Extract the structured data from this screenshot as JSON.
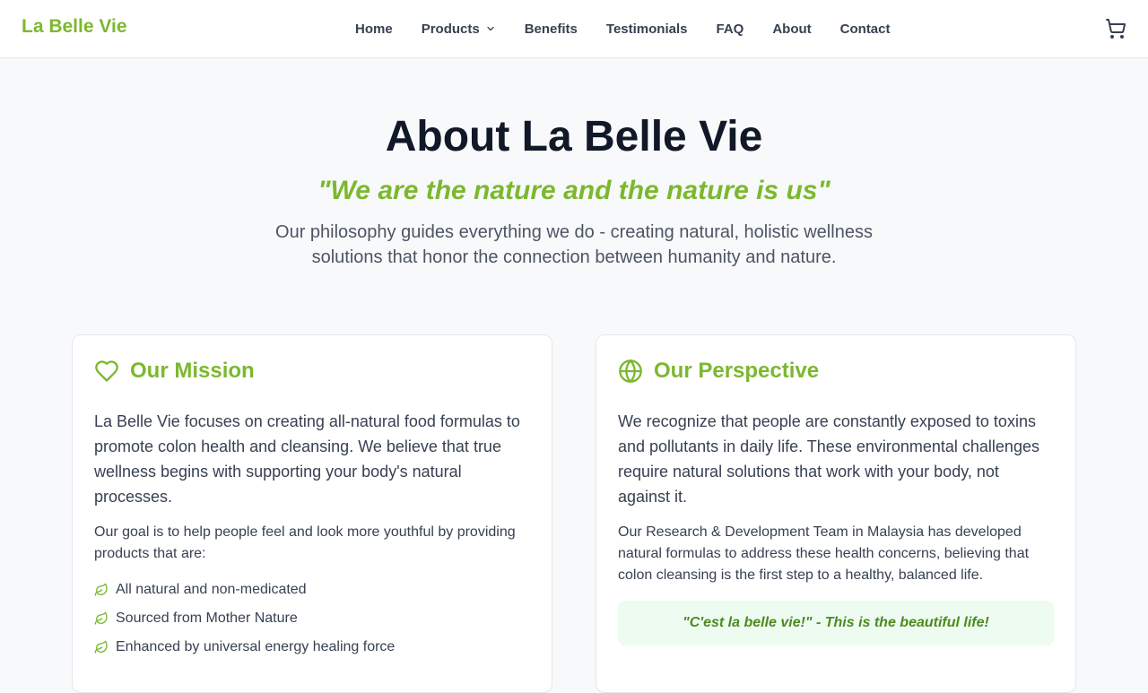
{
  "nav": {
    "brand": "La Belle Vie",
    "links": [
      {
        "label": "Home"
      },
      {
        "label": "Products"
      },
      {
        "label": "Benefits"
      },
      {
        "label": "Testimonials"
      },
      {
        "label": "FAQ"
      },
      {
        "label": "About"
      },
      {
        "label": "Contact"
      }
    ],
    "cart_icon": "shopping-cart-icon"
  },
  "hero": {
    "title": "About La Belle Vie",
    "tagline": "\"We are the nature and the nature is us\"",
    "philosophy": "Our philosophy guides everything we do - creating natural, holistic wellness solutions that honor the connection between humanity and nature."
  },
  "mission": {
    "icon": "heart-icon",
    "title": "Our Mission",
    "lead": "La Belle Vie focuses on creating all-natural food formulas to promote colon health and cleansing. We believe that true wellness begins with supporting your body's natural processes.",
    "body": "Our goal is to help people feel and look more youthful by providing products that are:",
    "items": [
      {
        "icon": "leaf-icon",
        "label": "All natural and non-medicated"
      },
      {
        "icon": "leaf-icon",
        "label": "Sourced from Mother Nature"
      },
      {
        "icon": "leaf-icon",
        "label": "Enhanced by universal energy healing force"
      }
    ]
  },
  "perspective": {
    "icon": "globe-icon",
    "title": "Our Perspective",
    "lead": "We recognize that people are constantly exposed to toxins and pollutants in daily life. These environmental challenges require natural solutions that work with your body, not against it.",
    "body": "Our Research & Development Team in Malaysia has developed natural formulas to address these health concerns, believing that colon cleansing is the first step to a healthy, balanced life.",
    "quote": "\"C'est la belle vie!\" - This is the beautiful life!"
  },
  "colors": {
    "accent": "#7cb82f",
    "heading": "#111827",
    "page_bg": "#f8f9fb",
    "quote_bg": "#eefbf1"
  }
}
